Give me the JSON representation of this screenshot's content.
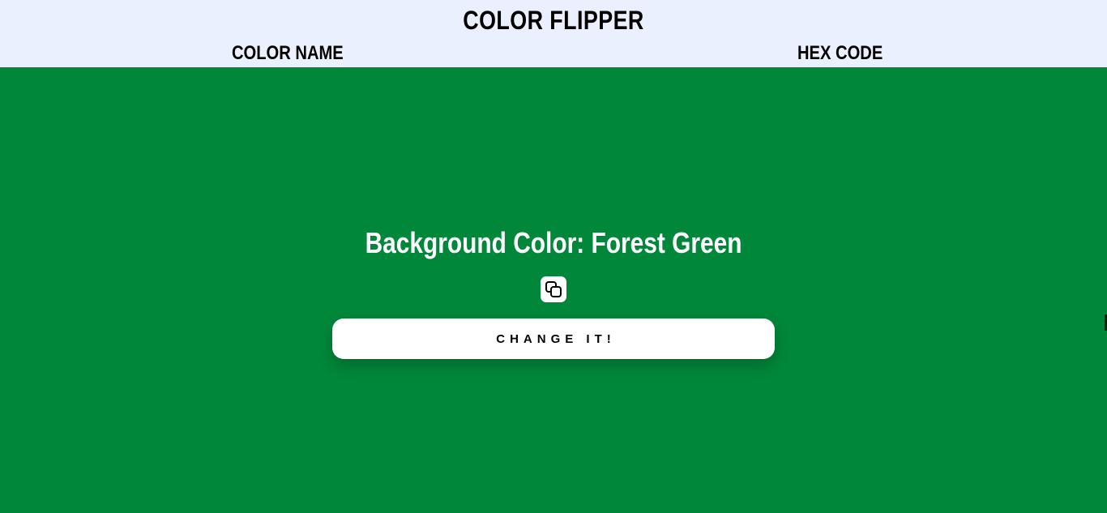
{
  "app": {
    "title": "COLOR FLIPPER"
  },
  "nav": {
    "color_name": "COLOR NAME",
    "hex_code": "HEX CODE"
  },
  "main": {
    "heading_prefix": "Background Color: ",
    "color_name": "Forest Green",
    "background_color": "#00873a",
    "copy_icon": "copy-icon",
    "button_label": "CHANGE IT!"
  },
  "colors": {
    "header_bg": "#ebf0ff",
    "text": "#000000",
    "heading_text": "#ffffff"
  }
}
